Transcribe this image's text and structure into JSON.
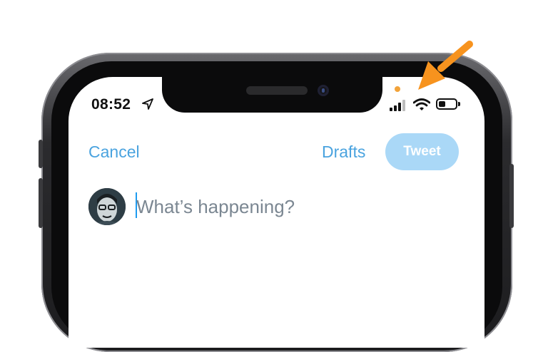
{
  "status_bar": {
    "time": "08:52",
    "location_icon": "location-arrow-icon",
    "signal_icon": "cellular-signal-icon",
    "wifi_icon": "wifi-icon",
    "battery_icon": "battery-icon",
    "battery_level": 0.4,
    "privacy_indicator_color": "#f2a33a"
  },
  "compose": {
    "cancel_label": "Cancel",
    "drafts_label": "Drafts",
    "tweet_label": "Tweet",
    "placeholder": "What’s happening?",
    "value": ""
  },
  "annotation": {
    "arrow_color": "#f7931e",
    "arrow_icon": "arrow-pointer-icon"
  },
  "colors": {
    "accent": "#4aa3df",
    "tweet_button_disabled": "#aad8f7"
  }
}
